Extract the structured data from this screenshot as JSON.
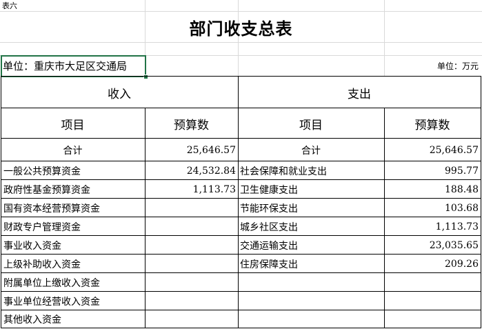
{
  "sheet_label": "表六",
  "title": "部门收支总表",
  "unit_left": "单位：重庆市大足区交通局",
  "unit_right": "单位：万元",
  "headers": {
    "income": "收入",
    "expense": "支出",
    "item": "项目",
    "budget": "预算数"
  },
  "total": {
    "income_label": "合计",
    "income_value": "25,646.57",
    "expense_label": "合计",
    "expense_value": "25,646.57"
  },
  "rows": [
    {
      "income_item": "一般公共预算资金",
      "income_value": "24,532.84",
      "expense_item": "社会保障和就业支出",
      "expense_value": "995.77"
    },
    {
      "income_item": "政府性基金预算资金",
      "income_value": "1,113.73",
      "expense_item": "卫生健康支出",
      "expense_value": "188.48"
    },
    {
      "income_item": "国有资本经营预算资金",
      "income_value": "",
      "expense_item": "节能环保支出",
      "expense_value": "103.68"
    },
    {
      "income_item": "财政专户管理资金",
      "income_value": "",
      "expense_item": "城乡社区支出",
      "expense_value": "1,113.73"
    },
    {
      "income_item": "事业收入资金",
      "income_value": "",
      "expense_item": "交通运输支出",
      "expense_value": "23,035.65"
    },
    {
      "income_item": "上级补助收入资金",
      "income_value": "",
      "expense_item": "住房保障支出",
      "expense_value": "209.26"
    },
    {
      "income_item": "附属单位上缴收入资金",
      "income_value": "",
      "expense_item": "",
      "expense_value": ""
    },
    {
      "income_item": "事业单位经营收入资金",
      "income_value": "",
      "expense_item": "",
      "expense_value": ""
    },
    {
      "income_item": "其他收入资金",
      "income_value": "",
      "expense_item": "",
      "expense_value": ""
    }
  ]
}
